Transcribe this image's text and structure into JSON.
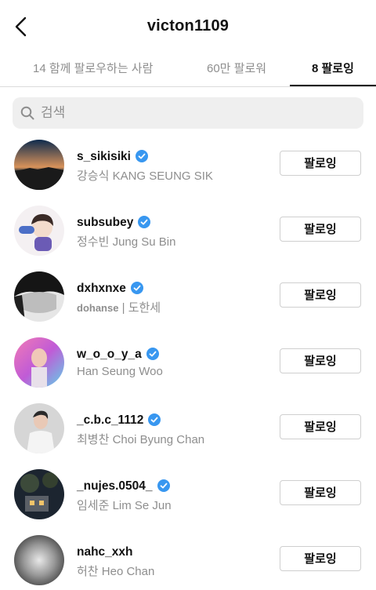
{
  "header": {
    "title": "victon1109",
    "back_icon": "chevron-left-icon"
  },
  "tabs": [
    {
      "label": "14 함께 팔로우하는 사람",
      "active": false
    },
    {
      "label": "60만 팔로워",
      "active": false
    },
    {
      "label": "8 팔로잉",
      "active": true
    }
  ],
  "search": {
    "placeholder": "검색",
    "icon": "search-icon"
  },
  "users": [
    {
      "username": "s_sikisiki",
      "verified": true,
      "full_name": "강승식 KANG SEUNG SIK",
      "button": "팔로잉"
    },
    {
      "username": "subsubey",
      "verified": true,
      "full_name": "정수빈 Jung Su Bin",
      "button": "팔로잉"
    },
    {
      "username": "dxhxnxe",
      "verified": true,
      "full_name_bold": "dohanse",
      "full_name": " | 도한세",
      "button": "팔로잉"
    },
    {
      "username": "w_o_o_y_a",
      "verified": true,
      "full_name": "Han Seung Woo",
      "button": "팔로잉"
    },
    {
      "username": "_c.b.c_1112",
      "verified": true,
      "full_name": "최병찬 Choi Byung Chan",
      "button": "팔로잉"
    },
    {
      "username": "_nujes.0504_",
      "verified": true,
      "full_name": "임세준 Lim Se Jun",
      "button": "팔로잉"
    },
    {
      "username": "nahc_xxh",
      "verified": false,
      "full_name": "허찬 Heo Chan",
      "button": "팔로잉"
    }
  ],
  "colors": {
    "verified": "#3897f0",
    "text_primary": "#262626",
    "text_secondary": "#8e8e8e",
    "search_bg": "#efefef"
  }
}
